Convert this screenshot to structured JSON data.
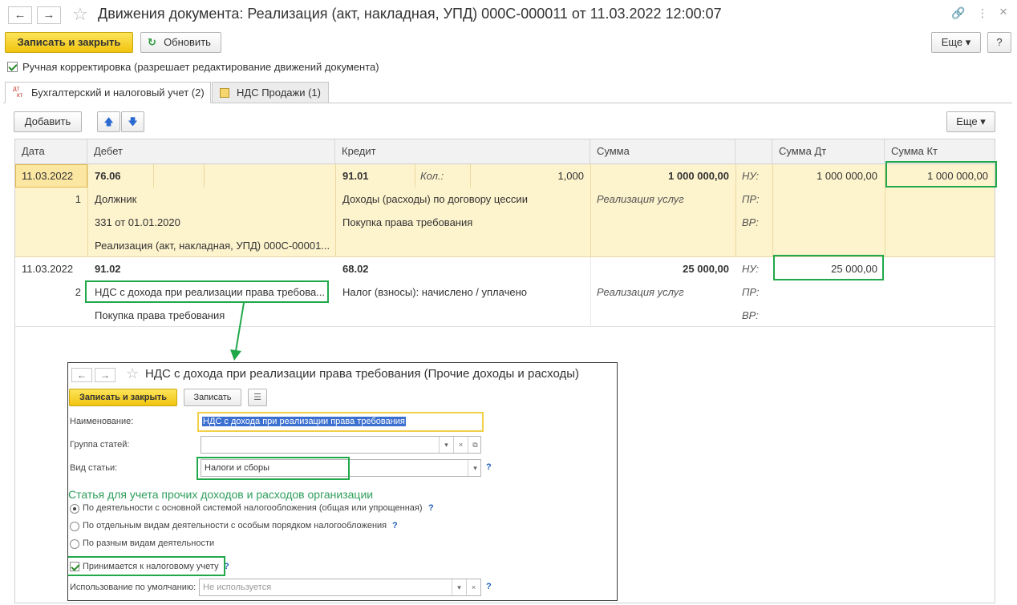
{
  "window": {
    "title": "Движения документа: Реализация (акт, накладная, УПД) 000С-000011 от 11.03.2022 12:00:07",
    "nav_back": "←",
    "nav_forward": "→",
    "star": "☆",
    "link_icon": "🔗",
    "menu_icon": "⋮",
    "close_icon": "×"
  },
  "toolbar": {
    "save_close_label": "Записать и закрыть",
    "refresh_label": "Обновить",
    "more_label": "Еще ▾",
    "help_label": "?"
  },
  "manual_edit": {
    "checked": true,
    "label": "Ручная корректировка (разрешает редактирование движений документа)"
  },
  "tabs": [
    {
      "label": "Бухгалтерский и налоговый учет (2)",
      "icon": "дт/кт"
    },
    {
      "label": "НДС Продажи (1)"
    }
  ],
  "tab_icon_dt": "дт",
  "tab_icon_kt": "кт",
  "table_toolbar": {
    "add_label": "Добавить",
    "up_icon": "🡅",
    "down_icon": "🡇",
    "more_label": "Еще ▾"
  },
  "columns": {
    "date": "Дата",
    "debit": "Дебет",
    "credit": "Кредит",
    "sum": "Сумма",
    "sum_dt": "Сумма Дт",
    "sum_kt": "Сумма Кт"
  },
  "rows": [
    {
      "date": "11.03.2022",
      "num": "1",
      "debit_account": "76.06",
      "debit_sub1": "Должник",
      "debit_sub2": "331 от 01.01.2020",
      "debit_sub3": "Реализация (акт, накладная, УПД) 000С-00001...",
      "credit_account": "91.01",
      "qty_label": "Кол.:",
      "qty": "1,000",
      "credit_sub1": "Доходы (расходы) по договору цессии",
      "credit_sub2": "Покупка права требования",
      "sum": "1 000 000,00",
      "sum_note": "Реализация услуг",
      "nu": "НУ:",
      "pr": "ПР:",
      "vr": "ВР:",
      "sum_dt": "1 000 000,00",
      "sum_kt": "1 000 000,00"
    },
    {
      "date": "11.03.2022",
      "num": "2",
      "debit_account": "91.02",
      "debit_sub1": "НДС с дохода при реализации права требова...",
      "debit_sub2": "Покупка права требования",
      "credit_account": "68.02",
      "credit_sub1": "Налог (взносы): начислено / уплачено",
      "sum": "25 000,00",
      "sum_note": "Реализация услуг",
      "nu": "НУ:",
      "pr": "ПР:",
      "vr": "ВР:",
      "sum_dt": "25 000,00"
    }
  ],
  "inset": {
    "title": "НДС с дохода при реализации права требования (Прочие доходы и расходы)",
    "save_close_label": "Записать и закрыть",
    "save_label": "Записать",
    "list_icon": "☰",
    "name_label": "Наименование:",
    "name_value": "НДС с дохода при реализации права требования",
    "group_label": "Группа статей:",
    "group_value": "",
    "type_label": "Вид статьи:",
    "type_value": "Налоги и сборы",
    "section_title": "Статья для учета прочих доходов и расходов организации",
    "radio_options": [
      {
        "label": "По деятельности с основной системой налогообложения (общая или упрощенная)",
        "selected": true
      },
      {
        "label": "По отдельным видам деятельности с особым порядком налогообложения",
        "selected": false
      },
      {
        "label": "По разным видам деятельности",
        "selected": false
      }
    ],
    "tax_accounting_label": "Принимается к налоговому учету",
    "tax_accounting_checked": true,
    "default_use_label": "Использование по умолчанию:",
    "default_use_placeholder": "Не используется",
    "help": "?"
  },
  "colors": {
    "accent_yellow": "#f1c40f",
    "highlight_green": "#21a84a",
    "selected_row": "#fdf3cd"
  }
}
